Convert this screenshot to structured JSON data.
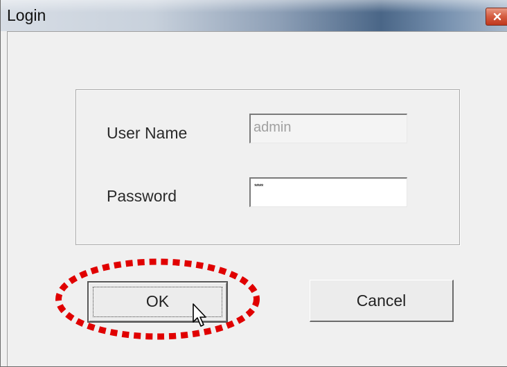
{
  "window": {
    "title": "Login",
    "close_icon": "close-icon"
  },
  "form": {
    "username_label": "User Name",
    "username_value": "admin",
    "password_label": "Password",
    "password_value": "*****"
  },
  "buttons": {
    "ok_label": "OK",
    "cancel_label": "Cancel"
  },
  "annotation": {
    "highlight_color": "#e00000",
    "highlight_shape": "dotted-ellipse",
    "target": "ok-button"
  },
  "cursor": {
    "icon": "mouse-pointer-icon"
  }
}
